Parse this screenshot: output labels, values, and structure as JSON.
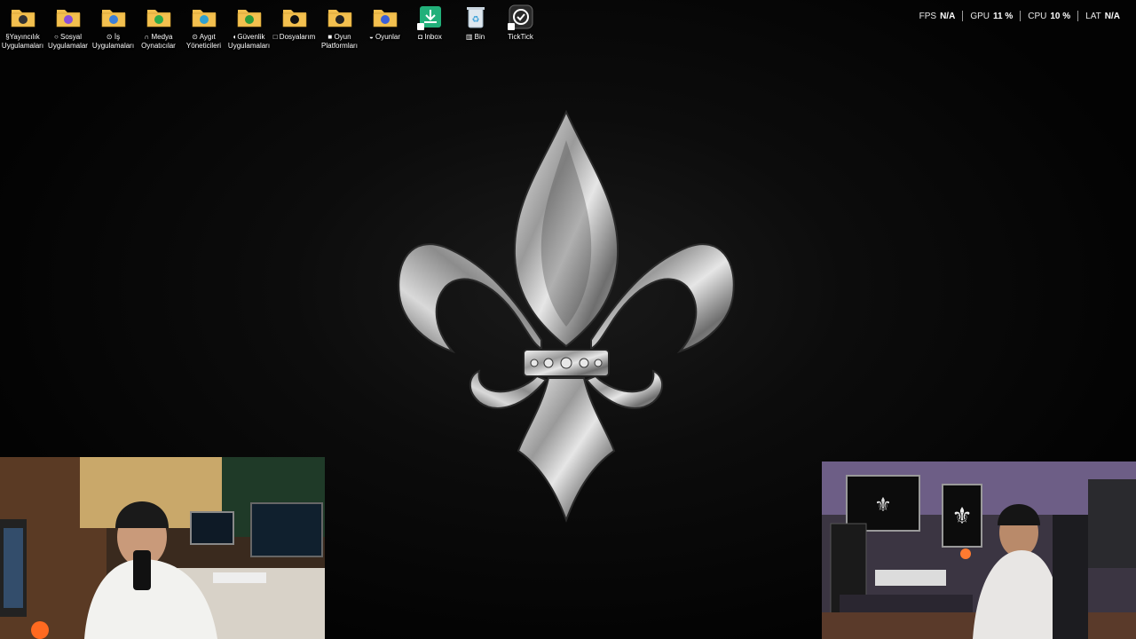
{
  "desktop": {
    "icons": [
      {
        "name": "yayincilik-folder",
        "label": "§Yayıncılık Uygulamaları",
        "color": "#f3c04f",
        "glyph": "#333"
      },
      {
        "name": "sosyal-folder",
        "label": "○ Sosyal Uygulamalar",
        "color": "#f3c04f",
        "glyph": "#8a4fd8"
      },
      {
        "name": "is-folder",
        "label": "⊙ İş Uygulamaları",
        "color": "#f3c04f",
        "glyph": "#3c7fd8"
      },
      {
        "name": "medya-folder",
        "label": "∩ Medya Oynatıcılar",
        "color": "#f3c04f",
        "glyph": "#2eaa4a"
      },
      {
        "name": "aygit-folder",
        "label": "⊙ Aygıt Yöneticileri",
        "color": "#f3c04f",
        "glyph": "#2fa0d0"
      },
      {
        "name": "guvenlik-folder",
        "label": "◐Güvenlik Uygulamaları",
        "color": "#f3c04f",
        "glyph": "#2e9a3a"
      },
      {
        "name": "dosyalarim-folder",
        "label": "□ Dosyalarım",
        "color": "#f3c04f",
        "glyph": "#111"
      },
      {
        "name": "oyun-platformlari-folder",
        "label": "■ Oyun Platformları",
        "color": "#f3c04f",
        "glyph": "#222"
      },
      {
        "name": "oyunlar-folder",
        "label": "◒ Oyunlar",
        "color": "#f3c04f",
        "glyph": "#3a5fd8"
      },
      {
        "name": "inbox-shortcut",
        "label": "◘ Inbox",
        "color": "#22b07a",
        "glyph": "#fff"
      },
      {
        "name": "bin-icon",
        "label": "▥ Bin",
        "color": "#dfe8ef",
        "glyph": "#3aa0d8"
      },
      {
        "name": "ticktick-shortcut",
        "label": "TickTick",
        "color": "#2a2a2a",
        "glyph": "#fff"
      }
    ]
  },
  "perf": {
    "fps_label": "FPS",
    "fps_value": "N/A",
    "gpu_label": "GPU",
    "gpu_value": "11 %",
    "cpu_label": "CPU",
    "cpu_value": "10 %",
    "lat_label": "LAT",
    "lat_value": "N/A"
  },
  "colors": {
    "background": "#050505",
    "emblem_silver": "#c8c8c8"
  }
}
